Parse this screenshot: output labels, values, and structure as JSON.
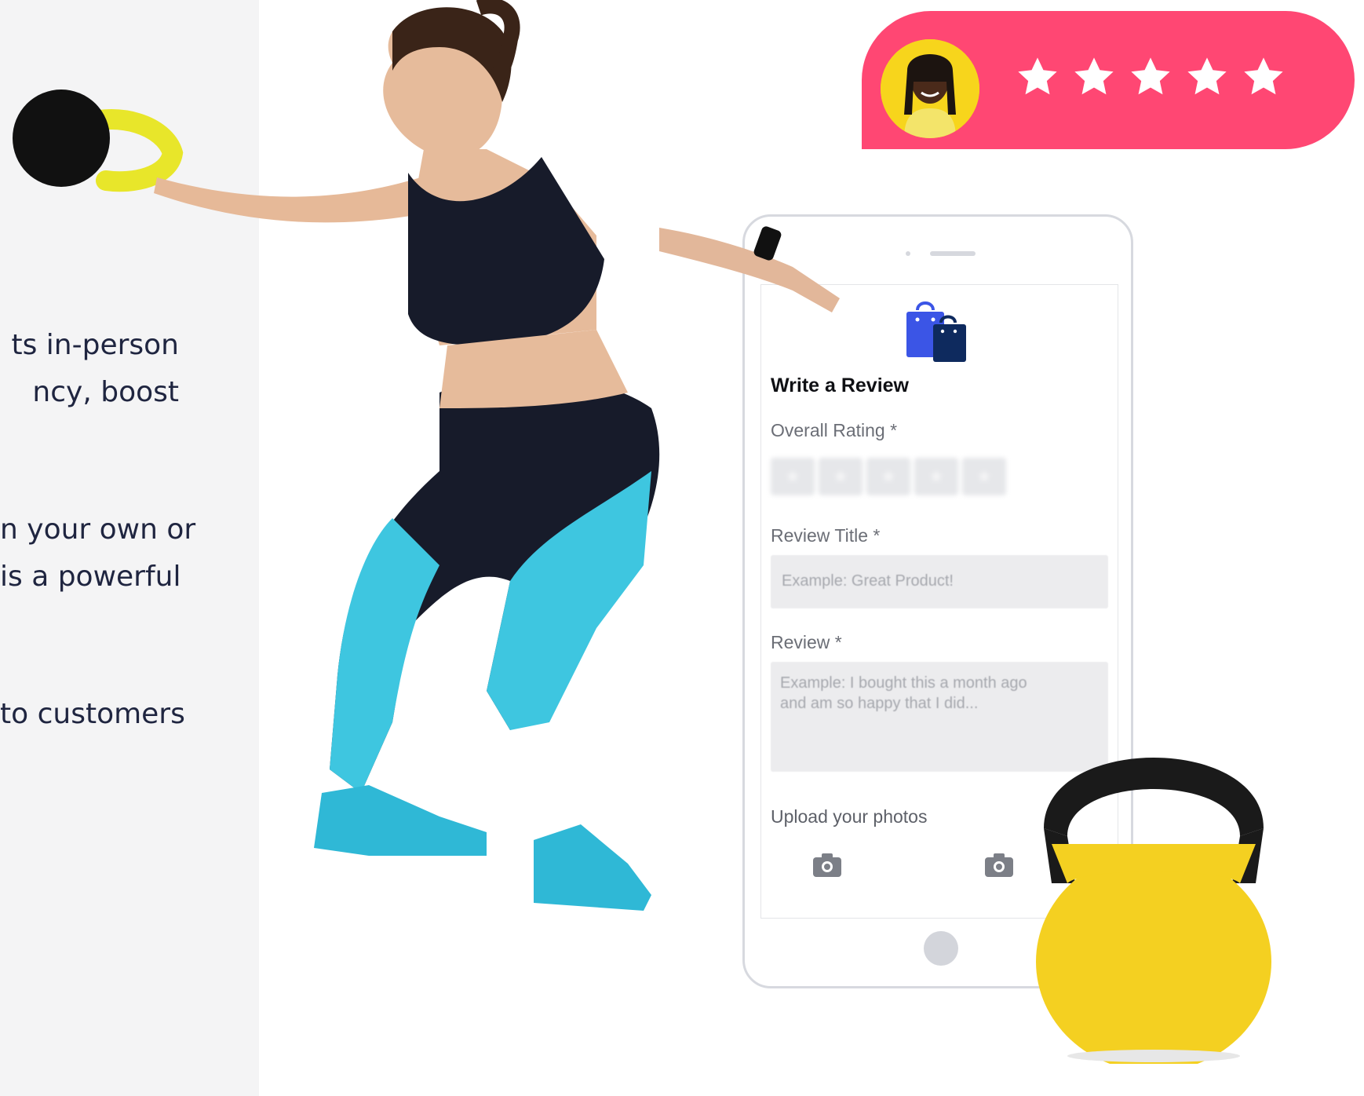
{
  "left_text": {
    "line1": "ts in-person",
    "line2": "ncy, boost",
    "line3": "n your own or",
    "line4": "is a powerful",
    "line5": "to customers"
  },
  "rating_badge": {
    "stars": 5,
    "star_color": "#ffffff",
    "background": "#ff4773"
  },
  "review_form": {
    "title": "Write a Review",
    "overall_rating_label": "Overall Rating *",
    "review_title_label": "Review Title *",
    "review_title_placeholder": "Example: Great Product!",
    "review_label": "Review *",
    "review_placeholder_line1": "Example: I bought this a month ago",
    "review_placeholder_line2": "and am so happy that I did...",
    "upload_label": "Upload your photos"
  },
  "colors": {
    "accent_pink": "#ff4773",
    "bag_blue": "#3b55e6",
    "bag_navy": "#0e2a5e",
    "kettlebell_yellow": "#f4d021",
    "leggings_teal": "#3ec6e0"
  }
}
